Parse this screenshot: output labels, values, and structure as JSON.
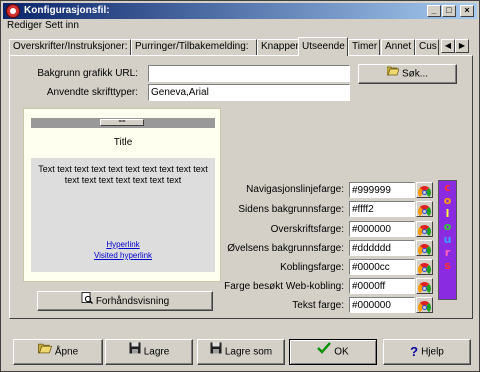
{
  "window": {
    "title": "Konfigurasjonsfil:",
    "buttons": {
      "minimize": "_",
      "maximize": "□",
      "close": "×"
    }
  },
  "menu": [
    "Rediger",
    "Sett inn"
  ],
  "tabs": [
    {
      "label": "Overskrifter/Instruksjoner:"
    },
    {
      "label": "Purringer/Tilbakemelding:"
    },
    {
      "label": "Knapper"
    },
    {
      "label": "Utseende",
      "active": true
    },
    {
      "label": "Timer"
    },
    {
      "label": "Annet"
    },
    {
      "label": "Cus"
    }
  ],
  "tab_scroll": {
    "left": "◀",
    "right": "▶"
  },
  "background": {
    "url_label": "Bakgrunn grafikk URL:",
    "url_value": "",
    "browse_label": "Søk..."
  },
  "fonts": {
    "label": "Anvendte skrifttyper:",
    "value": "Geneva,Arial"
  },
  "preview": {
    "nav_button": "==",
    "title": "Title",
    "body_text": "Text text text text text text text text text text text text text text text text text",
    "link1": "Hyperlink",
    "link2": "Visited hyperlink",
    "preview_button": "Forhåndsvisning"
  },
  "colors": [
    {
      "label": "Navigasjonslinjefarge:",
      "value": "#999999"
    },
    {
      "label": "Sidens bakgrunnsfarge:",
      "value": "#ffff2"
    },
    {
      "label": "Overskriftsfarge:",
      "value": "#000000"
    },
    {
      "label": "Øvelsens bakgrunnsfarge:",
      "value": "#dddddd"
    },
    {
      "label": "Koblingsfarge:",
      "value": "#0000cc"
    },
    {
      "label": "Farge besøkt Web-kobling:",
      "value": "#0000ff"
    },
    {
      "label": "Tekst farge:",
      "value": "#000000"
    }
  ],
  "colours_badge": [
    "c",
    "o",
    "l",
    "o",
    "u",
    "r",
    "s"
  ],
  "colours_badge_colors": [
    "#ff3030",
    "#ffa000",
    "#ffff40",
    "#30d030",
    "#40a0ff",
    "#ff60c0",
    "#ff3030"
  ],
  "bottom_buttons": {
    "open": "Åpne",
    "save": "Lagre",
    "save_as": "Lagre som",
    "ok": "OK",
    "help": "Hjelp"
  }
}
